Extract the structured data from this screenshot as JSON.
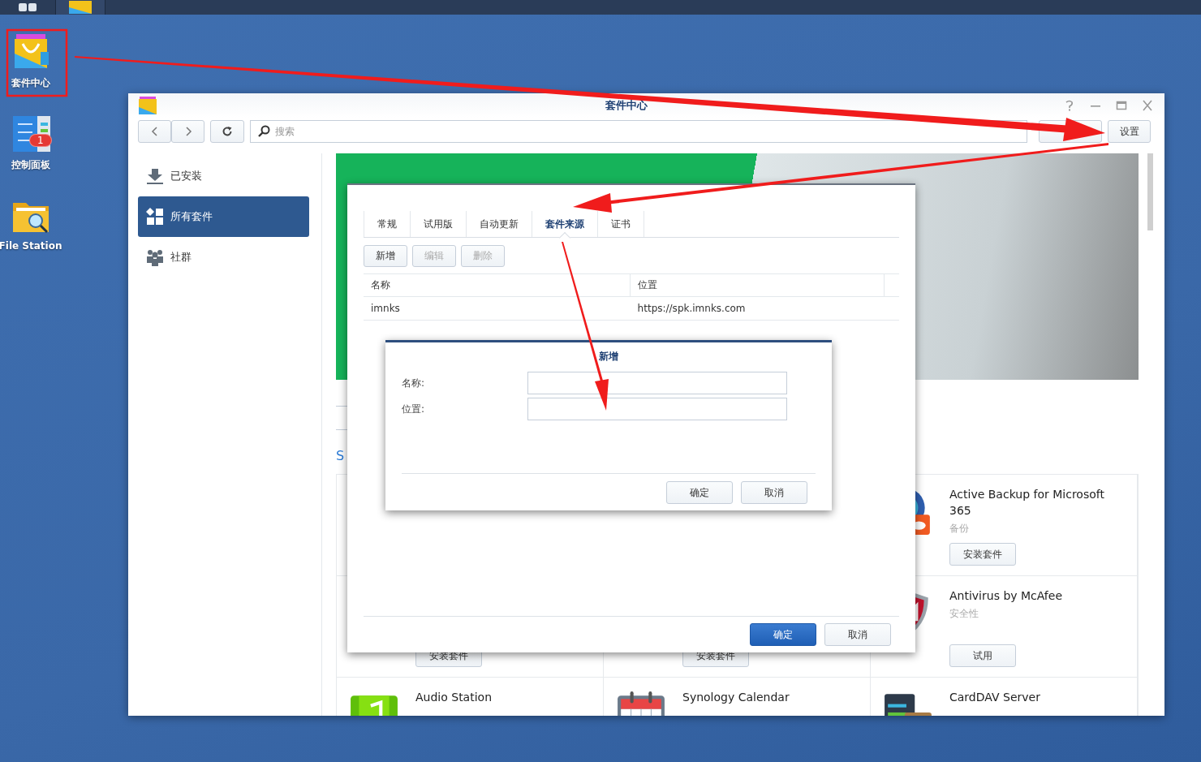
{
  "desktop_icons": [
    {
      "label": "套件中心"
    },
    {
      "label": "控制面板",
      "badge": "1"
    },
    {
      "label": "File Station"
    }
  ],
  "window": {
    "title": "套件中心",
    "search": {
      "placeholder": "搜索"
    },
    "toolbar_buttons": [
      "设置"
    ],
    "sidebar": {
      "items": [
        {
          "label": "已安装",
          "selected": false
        },
        {
          "label": "所有套件",
          "selected": true
        },
        {
          "label": "社群",
          "selected": false
        }
      ]
    },
    "section_link": "S",
    "packages": [
      {
        "name": "Active Backup for Microsoft 365",
        "category": "备份",
        "action": "安装套件"
      },
      {
        "action": "安装套件"
      },
      {
        "action": "安装套件"
      },
      {
        "name": "Antivirus by McAfee",
        "category": "安全性",
        "action": "试用"
      },
      {
        "name": "Audio Station"
      },
      {
        "name": "Synology Calendar"
      },
      {
        "name": "CardDAV Server"
      }
    ]
  },
  "settings_dialog": {
    "tabs": [
      {
        "label": "常规",
        "selected": false
      },
      {
        "label": "试用版",
        "selected": false
      },
      {
        "label": "自动更新",
        "selected": false
      },
      {
        "label": "套件来源",
        "selected": true
      },
      {
        "label": "证书",
        "selected": false
      }
    ],
    "buttons": [
      {
        "label": "新增",
        "disabled": false
      },
      {
        "label": "编辑",
        "disabled": true
      },
      {
        "label": "删除",
        "disabled": true
      }
    ],
    "table": {
      "columns": [
        "名称",
        "位置"
      ],
      "rows": [
        [
          "imnks",
          "https://spk.imnks.com"
        ]
      ]
    },
    "footer_buttons": [
      {
        "label": "确定",
        "kind": "primary"
      },
      {
        "label": "取消",
        "kind": "default"
      }
    ]
  },
  "add_dialog": {
    "title": "新增",
    "fields": [
      {
        "label": "名称:"
      },
      {
        "label": "位置:"
      }
    ],
    "buttons": [
      {
        "label": "确定",
        "kind": "default"
      },
      {
        "label": "取消",
        "kind": "default"
      }
    ]
  }
}
